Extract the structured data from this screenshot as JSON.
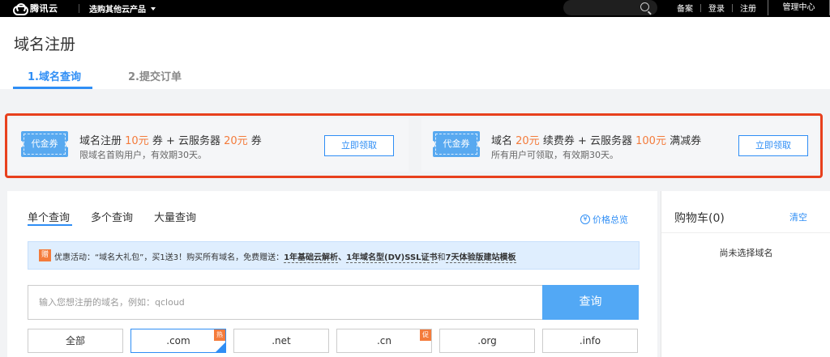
{
  "topbar": {
    "logo_text": "腾讯云",
    "products_label": "选购其他云产品",
    "links": [
      "备案",
      "登录",
      "注册"
    ],
    "console_label": "管理中心"
  },
  "header": {
    "title": "域名注册",
    "tabs": [
      "1.域名查询",
      "2.提交订单"
    ]
  },
  "promos": [
    {
      "coupon_label": "代金券",
      "line1": [
        "域名注册 ",
        "10元",
        " 券 + 云服务器 ",
        "20元",
        " 券"
      ],
      "line2": "限域名首购用户，有效期30天。",
      "button": "立即领取"
    },
    {
      "coupon_label": "代金券",
      "line1": [
        "域名 ",
        "20元",
        " 续费券 + 云服务器 ",
        "100元",
        " 满减券"
      ],
      "line2": "所有用户可领取，有效期30天。",
      "button": "立即领取"
    }
  ],
  "query": {
    "tabs": [
      "单个查询",
      "多个查询",
      "大量查询"
    ],
    "price_link": "价格总览",
    "notice": {
      "badge": "赠",
      "text_prefix": "优惠活动：“域名大礼包”，买1送3！购买所有域名，免费赠送：",
      "item1": "1年基础云解析",
      "sep1": "、",
      "item2": "1年域名型(DV)SSL证书",
      "sep2": "和",
      "item3": "7天体验版建站模板"
    },
    "input_placeholder": "输入您想注册的域名，例如：qcloud",
    "search_button": "查询",
    "suffixes": [
      {
        "label": "全部",
        "tag": ""
      },
      {
        "label": ".com",
        "tag": "热"
      },
      {
        "label": ".net",
        "tag": ""
      },
      {
        "label": ".cn",
        "tag": "促"
      },
      {
        "label": ".org",
        "tag": ""
      },
      {
        "label": ".info",
        "tag": ""
      }
    ]
  },
  "cart": {
    "title": "购物车(0)",
    "clear": "清空",
    "empty": "尚未选择域名"
  },
  "colors": {
    "accent": "#2f8ef5",
    "highlight": "#f47b3b",
    "promo_border": "#e8401d"
  }
}
